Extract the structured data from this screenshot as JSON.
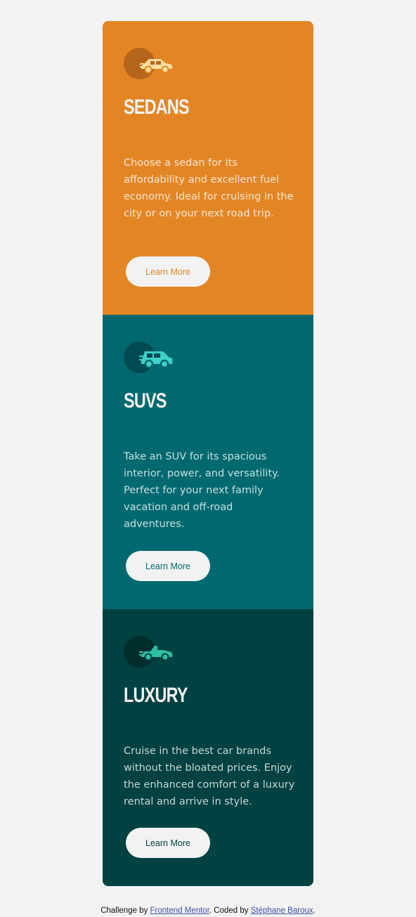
{
  "cards": [
    {
      "title": "SEDANS",
      "description": "Choose a sedan for its affordability and excellent fuel economy. Ideal for cruising in the city or on your next road trip.",
      "button_label": "Learn More",
      "icon": "sedan-car-icon",
      "background_color": "#e28625",
      "accent_color": "#e28625"
    },
    {
      "title": "SUVS",
      "description": "Take an SUV for its spacious interior, power, and versatility. Perfect for your next family vacation and off-road adventures.",
      "button_label": "Learn More",
      "icon": "suv-car-icon",
      "background_color": "#006970",
      "accent_color": "#006970"
    },
    {
      "title": "LUXURY",
      "description": "Cruise in the best car brands without the bloated prices. Enjoy the enhanced comfort of a luxury rental and arrive in style.",
      "button_label": "Learn More",
      "icon": "luxury-car-icon",
      "background_color": "#004141",
      "accent_color": "#004141"
    }
  ],
  "footer": {
    "prefix": "Challenge by ",
    "challenge_link": "Frontend Mentor",
    "middle": ". Coded by ",
    "author_link": "Stéphane Baroux",
    "suffix": "."
  }
}
